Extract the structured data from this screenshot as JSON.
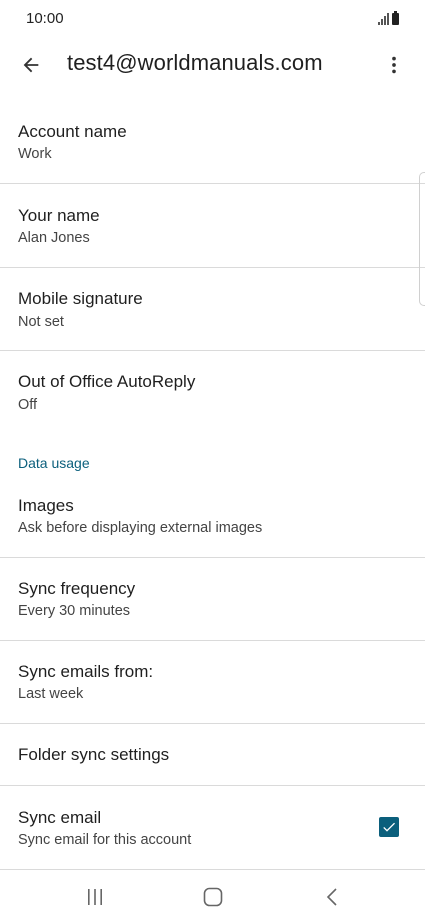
{
  "status_bar": {
    "time": "10:00"
  },
  "app_bar": {
    "title": "test4@worldmanuals.com"
  },
  "settings": {
    "account_name": {
      "title": "Account name",
      "summary": "Work"
    },
    "your_name": {
      "title": "Your name",
      "summary": "Alan Jones"
    },
    "mobile_signature": {
      "title": "Mobile signature",
      "summary": "Not set"
    },
    "out_of_office": {
      "title": "Out of Office AutoReply",
      "summary": "Off"
    },
    "data_usage_header": "Data usage",
    "images": {
      "title": "Images",
      "summary": "Ask before displaying external images"
    },
    "sync_frequency": {
      "title": "Sync frequency",
      "summary": "Every 30 minutes"
    },
    "sync_emails_from": {
      "title": "Sync emails from:",
      "summary": "Last week"
    },
    "folder_sync": {
      "title": "Folder sync settings"
    },
    "sync_email": {
      "title": "Sync email",
      "summary": "Sync email for this account",
      "checked": true
    }
  },
  "colors": {
    "accent": "#0b5f7c",
    "divider": "#dadada"
  },
  "icons": {
    "back": "arrow-left-icon",
    "overflow": "more-vert-icon",
    "recents": "recents-icon",
    "home": "home-icon",
    "nav_back": "chevron-left-icon"
  }
}
